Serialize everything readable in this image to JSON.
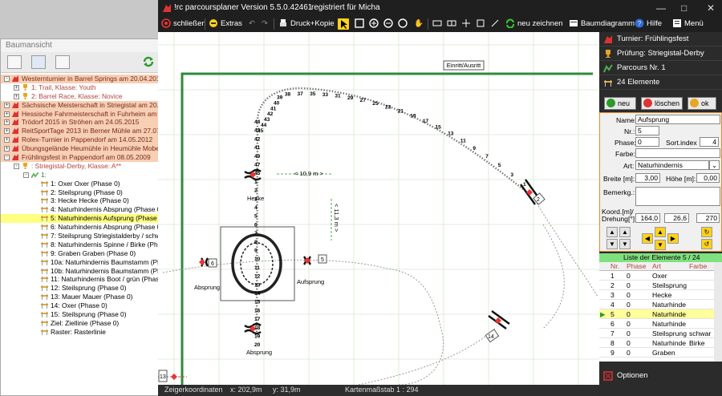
{
  "tree": {
    "title": "Baumansicht",
    "rows": [
      {
        "label": "Westernturnier in Barrel Springs am 20.04.2017",
        "indent": 0,
        "icon": "red-horse-icon",
        "exp": "-",
        "style": "hl"
      },
      {
        "label": "1: Trail, Klasse: Youth",
        "indent": 1,
        "icon": "trophy-icon",
        "exp": "+",
        "style": "red"
      },
      {
        "label": "2: Barrel Race, Klasse: Novice",
        "indent": 1,
        "icon": "trophy-icon",
        "exp": "+",
        "style": "red"
      },
      {
        "label": "Sächsische Meisterschaft in Striegistal am 20.04.2",
        "indent": 0,
        "icon": "red-horse-icon",
        "exp": "+",
        "style": "hl"
      },
      {
        "label": "Hessische Fahrmeisterschaft in Fuhrheim am 13.0",
        "indent": 0,
        "icon": "red-horse-icon",
        "exp": "+",
        "style": "hl"
      },
      {
        "label": "Trödorf 2015 in Ströhen am 24.05.2015",
        "indent": 0,
        "icon": "red-horse-icon",
        "exp": "+",
        "style": "hl"
      },
      {
        "label": "ReitSportTage 2013 in Berner Mühle am 27.07.20",
        "indent": 0,
        "icon": "red-horse-icon",
        "exp": "+",
        "style": "hl"
      },
      {
        "label": "Rolex-Turnier in Pappendorf am 14.05.2012",
        "indent": 0,
        "icon": "red-horse-icon",
        "exp": "+",
        "style": "hl"
      },
      {
        "label": "Übungsgelände Heumühle in Heumühle Mobendo",
        "indent": 0,
        "icon": "red-horse-icon",
        "exp": "+",
        "style": "hl"
      },
      {
        "label": "Frühlingsfest in Pappendorf am 08.05.2009",
        "indent": 0,
        "icon": "red-horse-icon",
        "exp": "-",
        "style": "hl"
      },
      {
        "label": ": Striegistal-Derby, Klasse: A**",
        "indent": 1,
        "icon": "trophy-icon",
        "exp": "-",
        "style": "red"
      },
      {
        "label": "1:",
        "indent": 2,
        "icon": "parcours-icon",
        "exp": "-",
        "style": "green"
      },
      {
        "label": "1: Oxer Oxer (Phase 0)",
        "indent": 3,
        "icon": "obstacle-icon",
        "exp": "",
        "style": ""
      },
      {
        "label": "2: Steilsprung  (Phase 0)",
        "indent": 3,
        "icon": "obstacle-icon",
        "exp": "",
        "style": ""
      },
      {
        "label": "3: Hecke Hecke (Phase 0)",
        "indent": 3,
        "icon": "obstacle-icon",
        "exp": "",
        "style": ""
      },
      {
        "label": "4: Naturhindernis Absprung (Phase 0)",
        "indent": 3,
        "icon": "obstacle-icon",
        "exp": "",
        "style": ""
      },
      {
        "label": "5: Naturhindernis Aufsprung (Phase 0)",
        "indent": 3,
        "icon": "obstacle-icon",
        "exp": "",
        "style": "sel"
      },
      {
        "label": "6: Naturhindernis Absprung (Phase 0)",
        "indent": 3,
        "icon": "obstacle-icon",
        "exp": "",
        "style": ""
      },
      {
        "label": "7: Steilsprung Striegistalderby / schwarz-w",
        "indent": 3,
        "icon": "obstacle-icon",
        "exp": "",
        "style": ""
      },
      {
        "label": "8: Naturhindernis Spinne / Birke (Phase 0)",
        "indent": 3,
        "icon": "obstacle-icon",
        "exp": "",
        "style": ""
      },
      {
        "label": "9: Graben Graben (Phase 0)",
        "indent": 3,
        "icon": "obstacle-icon",
        "exp": "",
        "style": ""
      },
      {
        "label": "10a: Naturhindernis Baumstamm (Phase 0)",
        "indent": 3,
        "icon": "obstacle-icon",
        "exp": "",
        "style": ""
      },
      {
        "label": "10b: Naturhindernis Baumstamm (Phase 0)",
        "indent": 3,
        "icon": "obstacle-icon",
        "exp": "",
        "style": ""
      },
      {
        "label": "11: Naturhindernis Boot / grün (Phase 0)",
        "indent": 3,
        "icon": "obstacle-icon",
        "exp": "",
        "style": ""
      },
      {
        "label": "12: Steilsprung  (Phase 0)",
        "indent": 3,
        "icon": "obstacle-icon",
        "exp": "",
        "style": ""
      },
      {
        "label": "13: Mauer Mauer (Phase 0)",
        "indent": 3,
        "icon": "obstacle-icon",
        "exp": "",
        "style": ""
      },
      {
        "label": "14: Oxer  (Phase 0)",
        "indent": 3,
        "icon": "obstacle-icon",
        "exp": "",
        "style": ""
      },
      {
        "label": "15: Steilsprung  (Phase 0)",
        "indent": 3,
        "icon": "obstacle-icon",
        "exp": "",
        "style": ""
      },
      {
        "label": "Ziel: Ziellinie  (Phase 0)",
        "indent": 3,
        "icon": "obstacle-icon",
        "exp": "",
        "style": ""
      },
      {
        "label": "Raster: Rasterlinie",
        "indent": 3,
        "icon": "obstacle-icon",
        "exp": "",
        "style": ""
      }
    ]
  },
  "app": {
    "title": "!rc parcoursplaner  Version 5.5.0.42461",
    "registered": "registriert für Micha",
    "toolbar": {
      "close": "schließen",
      "extras": "Extras",
      "print": "Druck+Kopie",
      "redraw": "neu zeichnen",
      "tree_diagram": "Baumdiagramm",
      "help": "Hilfe",
      "menu": "Menü"
    }
  },
  "canvas": {
    "entry_label": "Einritt/Ausritt",
    "dim_horizontal": "< 10,9 m >",
    "dim_vertical": "< 11,3 m >",
    "labels": {
      "absprung_left": "Absprung",
      "aufsprung": "Aufsprung",
      "absprung_bottom": "Absprung",
      "hecke": "Hecke",
      "num_2": "2",
      "num_6": "6",
      "num_5": "5",
      "num_14": "14",
      "num_13": "13"
    },
    "curve_numbers": [
      "45",
      "44",
      "43",
      "42",
      "41",
      "40",
      "39",
      "38",
      "37",
      "35",
      "33",
      "31",
      "29",
      "27",
      "25",
      "23",
      "21",
      "19",
      "17",
      "15",
      "13",
      "11",
      "9",
      "7",
      "5",
      "3",
      "1"
    ],
    "column_numbers": [
      "44",
      "43",
      "42",
      "41",
      "49",
      "47",
      "45",
      "1",
      "2",
      "3",
      "4",
      "5",
      "6",
      "7",
      "8",
      "9",
      "10",
      "11",
      "12",
      "13",
      "14",
      "15",
      "16",
      "17",
      "18",
      "19",
      "20"
    ]
  },
  "status": {
    "coords_label": "Zeigerkoordinaten",
    "x": "x: 202,9m",
    "y": "y: 31,9m",
    "scale": "Kartenmaßstab 1 : 294"
  },
  "panel": {
    "turnier": "Turnier: Frühlingsfest",
    "pruefung": "Prüfung: Striegistal-Derby",
    "parcours": "Parcours  Nr. 1",
    "elemente": "24 Elemente",
    "btn_new": "neu",
    "btn_delete": "löschen",
    "btn_ok": "ok",
    "form": {
      "name_label": "Name:",
      "name": "Aufsprung",
      "nr_label": "Nr.:",
      "nr": "5",
      "phase_label": "Phase:",
      "phase": "0",
      "sort_label": "Sort.index",
      "sort": "4",
      "farbe_label": "Farbe:",
      "farbe": "",
      "art_label": "Art:",
      "art": "Naturhindernis",
      "breite_label": "Breite [m]:",
      "breite": "3,00",
      "hoehe_label": "Höhe [m]:",
      "hoehe": "0,00",
      "bemerk_label": "Bemerkg.:",
      "koord_label": "Koord.[m]/",
      "dreh_label": "Drehung[°]",
      "kx": "164,0",
      "ky": "26,6",
      "rot": "270"
    },
    "list_title": "Liste der Elemente",
    "list_pos": "5 / 24",
    "cols": [
      "Nr.",
      "Phase",
      "Art",
      "Farbe"
    ],
    "rows": [
      [
        "1",
        "0",
        "Oxer",
        ""
      ],
      [
        "2",
        "0",
        "Steilsprung",
        ""
      ],
      [
        "3",
        "0",
        "Hecke",
        ""
      ],
      [
        "4",
        "0",
        "Naturhinde",
        ""
      ],
      [
        "5",
        "0",
        "Naturhinde",
        ""
      ],
      [
        "6",
        "0",
        "Naturhinde",
        ""
      ],
      [
        "7",
        "0",
        "Steilsprung",
        "schwar"
      ],
      [
        "8",
        "0",
        "Naturhinde",
        "Birke"
      ],
      [
        "9",
        "0",
        "Graben",
        ""
      ]
    ],
    "options": "Optionen"
  }
}
